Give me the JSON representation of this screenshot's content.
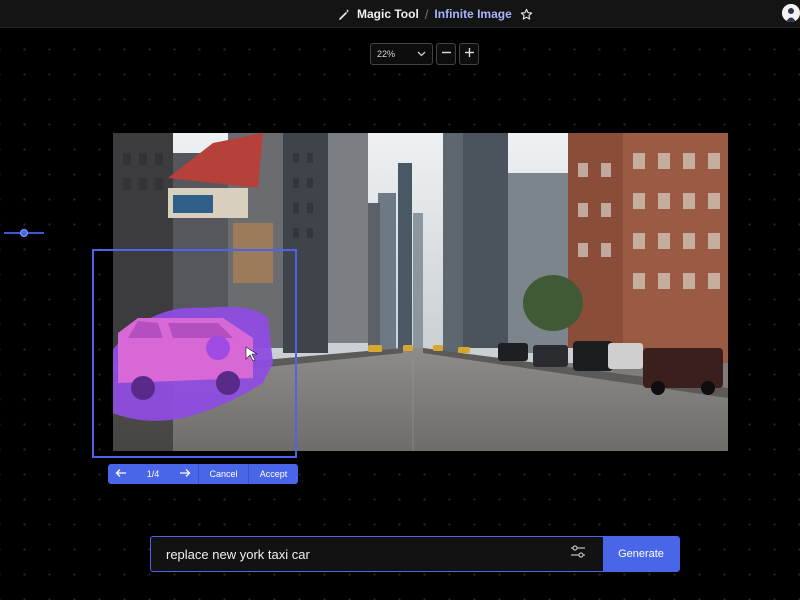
{
  "header": {
    "tool_name": "Magic Tool",
    "separator": "/",
    "page_title": "Infinite Image",
    "icons": [
      "magic-wand-icon",
      "star-icon",
      "user-avatar"
    ]
  },
  "zoom": {
    "level": "22%",
    "icons": [
      "chevron-down-icon",
      "minus-icon",
      "plus-icon"
    ]
  },
  "selection_toolbar": {
    "prev_icon": "arrow-left-icon",
    "page_indicator": "1/4",
    "next_icon": "arrow-right-icon",
    "cancel_label": "Cancel",
    "accept_label": "Accept"
  },
  "prompt": {
    "value": "replace new york taxi car",
    "settings_icon": "sliders-icon",
    "generate_label": "Generate"
  },
  "colors": {
    "accent": "#4a66e8",
    "mask": "#a64ee8",
    "background": "#000000"
  }
}
